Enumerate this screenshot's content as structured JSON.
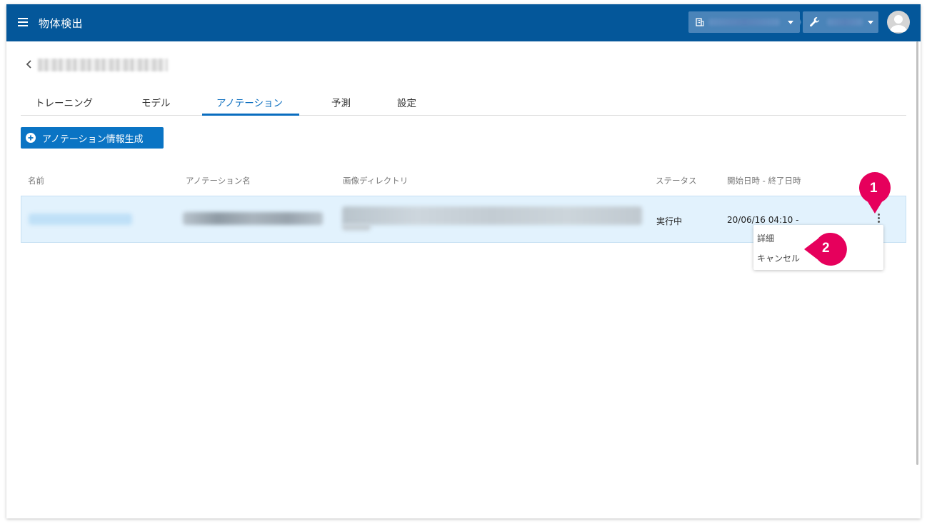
{
  "header": {
    "title": "物体検出",
    "org_selector": {
      "value": ""
    },
    "project_selector": {
      "value": ""
    }
  },
  "breadcrumb": {
    "text": ""
  },
  "tabs": [
    {
      "label": "トレーニング",
      "active": false
    },
    {
      "label": "モデル",
      "active": false
    },
    {
      "label": "アノテーション",
      "active": true
    },
    {
      "label": "予測",
      "active": false
    },
    {
      "label": "設定",
      "active": false
    }
  ],
  "actions": {
    "generate_label": "アノテーション情報生成"
  },
  "table": {
    "columns": [
      "名前",
      "アノテーション名",
      "画像ディレクトリ",
      "ステータス",
      "開始日時 - 終了日時"
    ],
    "rows": [
      {
        "name": "",
        "annotation_name": "",
        "image_directory": "",
        "status": "実行中",
        "datetime": "20/06/16 04:10 -"
      }
    ]
  },
  "row_menu": {
    "items": [
      "詳細",
      "キャンセル"
    ]
  },
  "callouts": [
    "1",
    "2"
  ],
  "colors": {
    "appbar": "#04579a",
    "accent": "#0a6dbf",
    "callout": "#e6005c",
    "row_highlight": "#e2f2fd"
  }
}
